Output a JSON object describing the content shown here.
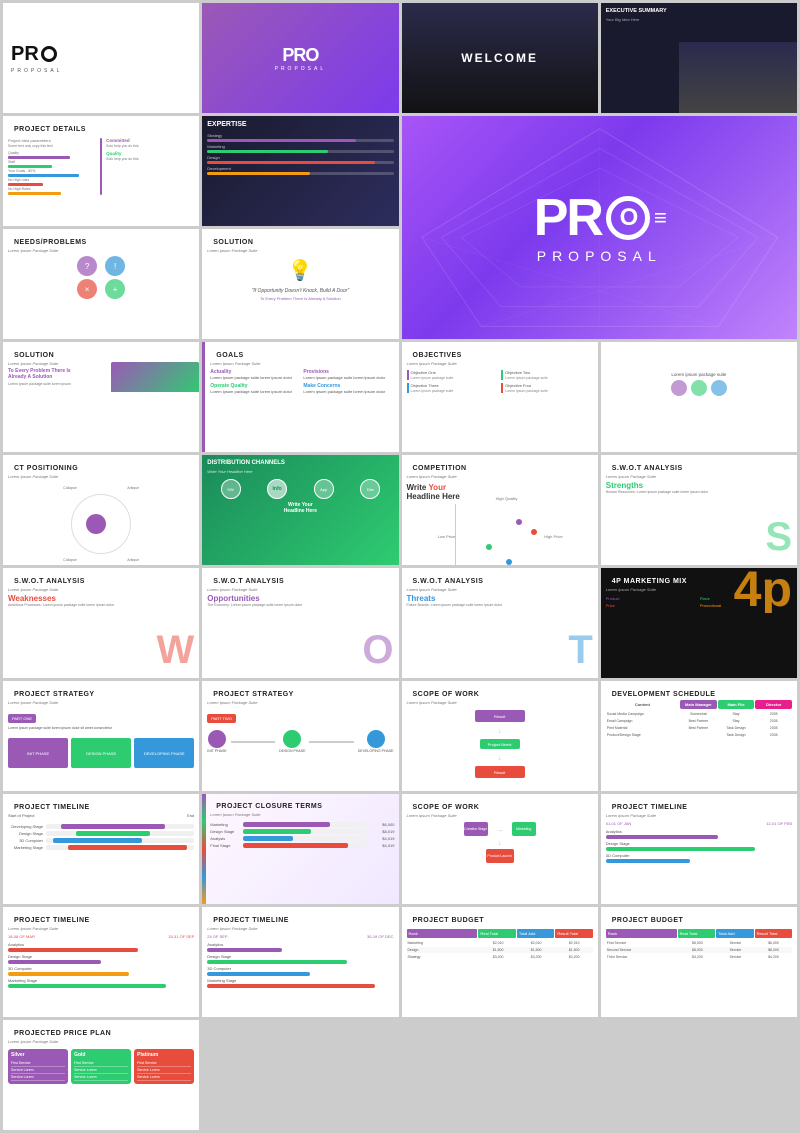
{
  "hero": {
    "logo_pro": "PRO",
    "logo_proposal": "PROPOSAL",
    "tagline": "PROPOSAL"
  },
  "slides": [
    {
      "id": "slide-1",
      "type": "pro-logo",
      "title": "PRO",
      "subtitle": "PROPOSAL"
    },
    {
      "id": "slide-2",
      "type": "purple-logo",
      "title": "PRO",
      "subtitle": "PROPOSAL"
    },
    {
      "id": "slide-3",
      "type": "welcome-dark",
      "title": "WELCOME"
    },
    {
      "id": "slide-4",
      "type": "exec-summary",
      "title": "EXECUTIVE SUMMARY",
      "sub": "Your Big Idea Here"
    },
    {
      "id": "slide-5",
      "type": "project-details",
      "title": "PROJECT DETAILS"
    },
    {
      "id": "slide-6",
      "type": "expertise",
      "title": "EXPERTISE"
    },
    {
      "id": "slide-7",
      "type": "needs-problems",
      "title": "NEEDS/PROBLEMS"
    },
    {
      "id": "slide-8",
      "type": "solution",
      "title": "SOLUTION"
    },
    {
      "id": "slide-9",
      "type": "solution-img",
      "title": "SOLUTION",
      "sub": "Lorem Ipsum Package Suite"
    },
    {
      "id": "slide-10",
      "type": "goals",
      "title": "GOALS"
    },
    {
      "id": "slide-11",
      "type": "objectives",
      "title": "OBJECTIVES",
      "items": [
        "Objective One",
        "Objective Two",
        "Objective Three",
        "Objective Four"
      ]
    },
    {
      "id": "slide-12",
      "type": "product-positioning",
      "title": "CT POSITIONING"
    },
    {
      "id": "slide-13",
      "type": "distribution",
      "title": "DISTRIBUTION CHANNELS",
      "sub": "Write Your Headline Here"
    },
    {
      "id": "slide-14",
      "type": "competition",
      "title": "COMPETITION",
      "sub": "Lorem Ipsum Package Suite",
      "headline": "Write Your Headline Here"
    },
    {
      "id": "slide-15",
      "type": "swot-s",
      "title": "S.W.O.T ANALYSIS",
      "sub": "Lorem Ipsum Package Suite",
      "letter": "S",
      "section": "Strengths"
    },
    {
      "id": "slide-16",
      "type": "swot-w",
      "title": "S.W.O.T ANALYSIS",
      "sub": "Lorem Ipsum Package Suite",
      "letter": "W",
      "section": "Weaknesses"
    },
    {
      "id": "slide-17",
      "type": "swot-o",
      "title": "S.W.O.T ANALYSIS",
      "letter": "O",
      "section": "Opportunities"
    },
    {
      "id": "slide-18",
      "type": "swot-t",
      "title": "S.W.O.T ANALYSIS",
      "letter": "T",
      "section": "Threats"
    },
    {
      "id": "slide-19",
      "type": "4p-marketing",
      "title": "4P MARKETING MIX",
      "sub": "Lorem Ipsum Package Suite"
    },
    {
      "id": "slide-20",
      "type": "project-strategy-1",
      "title": "PROJECT STRATEGY"
    },
    {
      "id": "slide-21",
      "type": "project-strategy-2",
      "title": "PROJECT STRATEGY"
    },
    {
      "id": "slide-22",
      "type": "scope-of-work",
      "title": "SCOPE OF WORK",
      "sub": "Lorem Ipsum Package Suite"
    },
    {
      "id": "slide-23",
      "type": "dev-schedule",
      "title": "DEVELOPMENT SCHEDULE"
    },
    {
      "id": "slide-24",
      "type": "project-timeline-1",
      "title": "PROJECT TIMELINE"
    },
    {
      "id": "slide-25",
      "type": "project-closure",
      "title": "PROJECT CLOSURE TERMS",
      "sub": "Lorem Ipsum Package Suite"
    },
    {
      "id": "slide-26",
      "type": "scope-of-work-2",
      "title": "SCOPE OF WORK",
      "sub": "Lorem Ipsum Package Suite"
    },
    {
      "id": "slide-27",
      "type": "project-timeline-2",
      "title": "PROJECT TIMELINE",
      "sub": "Lorem Ipsum Package Suite"
    },
    {
      "id": "slide-28",
      "type": "project-timeline-3",
      "title": "PROJECT TIMELINE",
      "sub": "Lorem Ipsum Package Suite"
    },
    {
      "id": "slide-29",
      "type": "project-timeline-4",
      "title": "PROJECT TIMELINE"
    },
    {
      "id": "slide-30",
      "type": "project-budget-1",
      "title": "PROJECT BUDGET"
    },
    {
      "id": "slide-31",
      "type": "project-budget-2",
      "title": "PROJECT BUDGET"
    },
    {
      "id": "slide-32",
      "type": "projected-price",
      "title": "PROJECTED PRICE PLAN"
    }
  ],
  "colors": {
    "purple": "#9b59b6",
    "green": "#2ecc71",
    "red": "#e74c3c",
    "blue": "#3498db",
    "dark": "#1a1a2e",
    "teal": "#1abc9c",
    "orange": "#e67e22",
    "pink": "#e91e8c",
    "light_purple": "#c084fc",
    "yellow": "#f0c040"
  }
}
